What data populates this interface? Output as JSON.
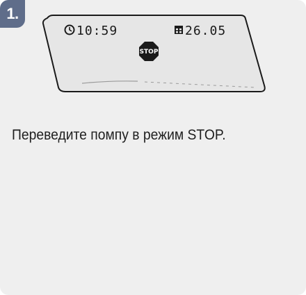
{
  "step": {
    "number": "1."
  },
  "display": {
    "time": "10:59",
    "date": "26.05",
    "stop_symbol": "STOP",
    "icons": {
      "time": "clock-icon",
      "date": "calendar-icon",
      "stop": "stop-sign-icon"
    }
  },
  "instruction": {
    "text": "Переведите помпу в режим STOP."
  },
  "colors": {
    "badge": "#5f6d8a",
    "card_background": "#efefef",
    "lcd_background": "#e6e6e6"
  }
}
